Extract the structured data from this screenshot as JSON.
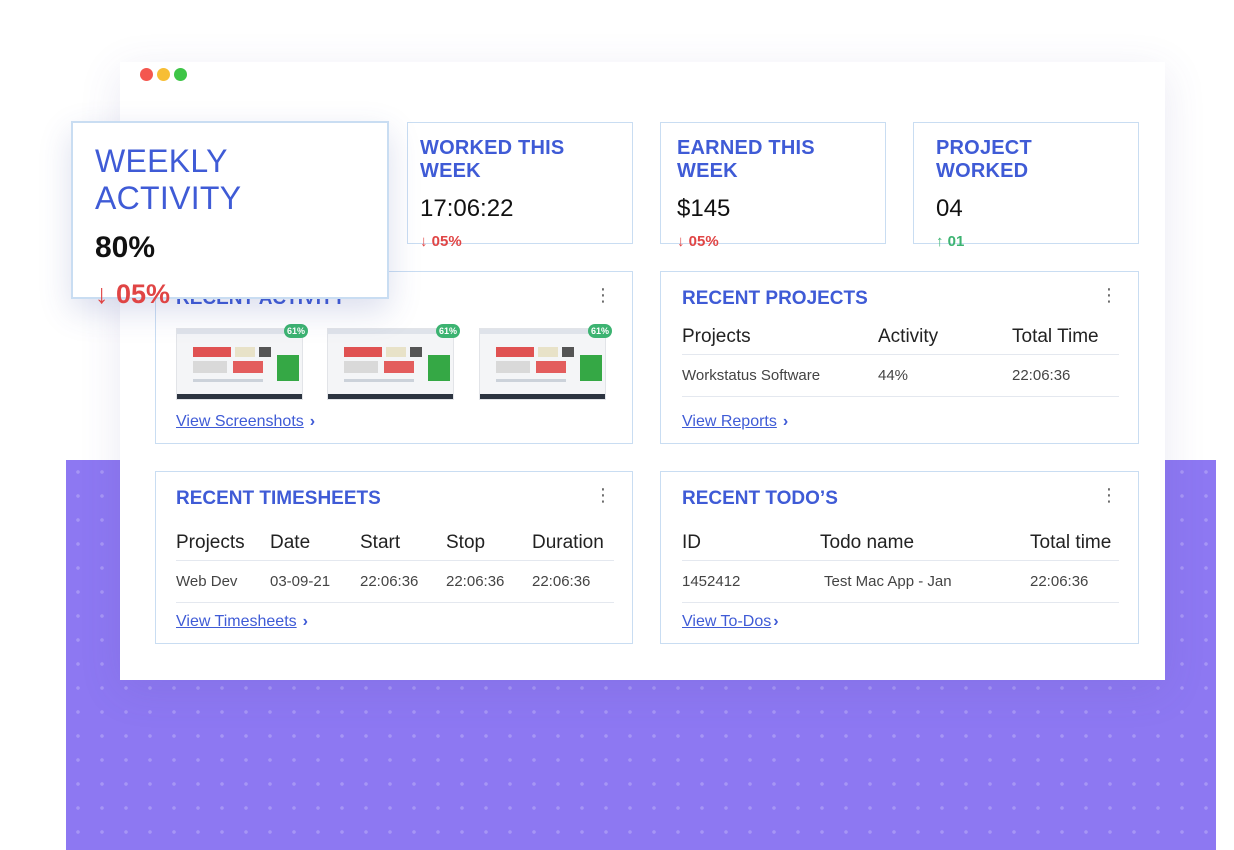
{
  "window": {
    "controls": [
      "close",
      "minimize",
      "maximize"
    ],
    "dot_colors": [
      "#f4574f",
      "#f7be35",
      "#3ec547"
    ]
  },
  "stats": {
    "weekly_activity": {
      "title": "WEEKLY ACTIVITY",
      "value": "80%",
      "change": "↓ 05%",
      "trend": "down"
    },
    "worked": {
      "title": "WORKED THIS WEEK",
      "value": "17:06:22",
      "change": "↓ 05%",
      "trend": "down"
    },
    "earned": {
      "title": "EARNED THIS WEEK",
      "value": "$145",
      "change": "↓ 05%",
      "trend": "down"
    },
    "projects": {
      "title": "PROJECT WORKED",
      "value": "04",
      "change": "↑ 01",
      "trend": "up"
    }
  },
  "recent_activity": {
    "title": "RECENT ACTIVITY",
    "screenshots": [
      {
        "activity": "61%"
      },
      {
        "activity": "61%"
      },
      {
        "activity": "61%"
      }
    ],
    "link": "View Screenshots"
  },
  "recent_projects": {
    "title": "RECENT PROJECTS",
    "columns": [
      "Projects",
      "Activity",
      "Total Time"
    ],
    "rows": [
      [
        "Workstatus Software",
        "44%",
        "22:06:36"
      ]
    ],
    "link": "View Reports"
  },
  "recent_timesheets": {
    "title": "RECENT TIMESHEETS",
    "columns": [
      "Projects",
      "Date",
      "Start",
      "Stop",
      "Duration"
    ],
    "rows": [
      [
        "Web Dev",
        "03-09-21",
        "22:06:36",
        "22:06:36",
        "22:06:36"
      ]
    ],
    "link": "View Timesheets"
  },
  "recent_todos": {
    "title": "RECENT TODO’S",
    "columns": [
      "ID",
      "Todo name",
      "Total time"
    ],
    "rows": [
      [
        "1452412",
        "Test Mac App - Jan",
        "22:06:36"
      ]
    ],
    "link": "View To-Dos"
  },
  "icons": {
    "menu": "kebab-menu-icon",
    "chevron": "chevron-right-icon"
  }
}
